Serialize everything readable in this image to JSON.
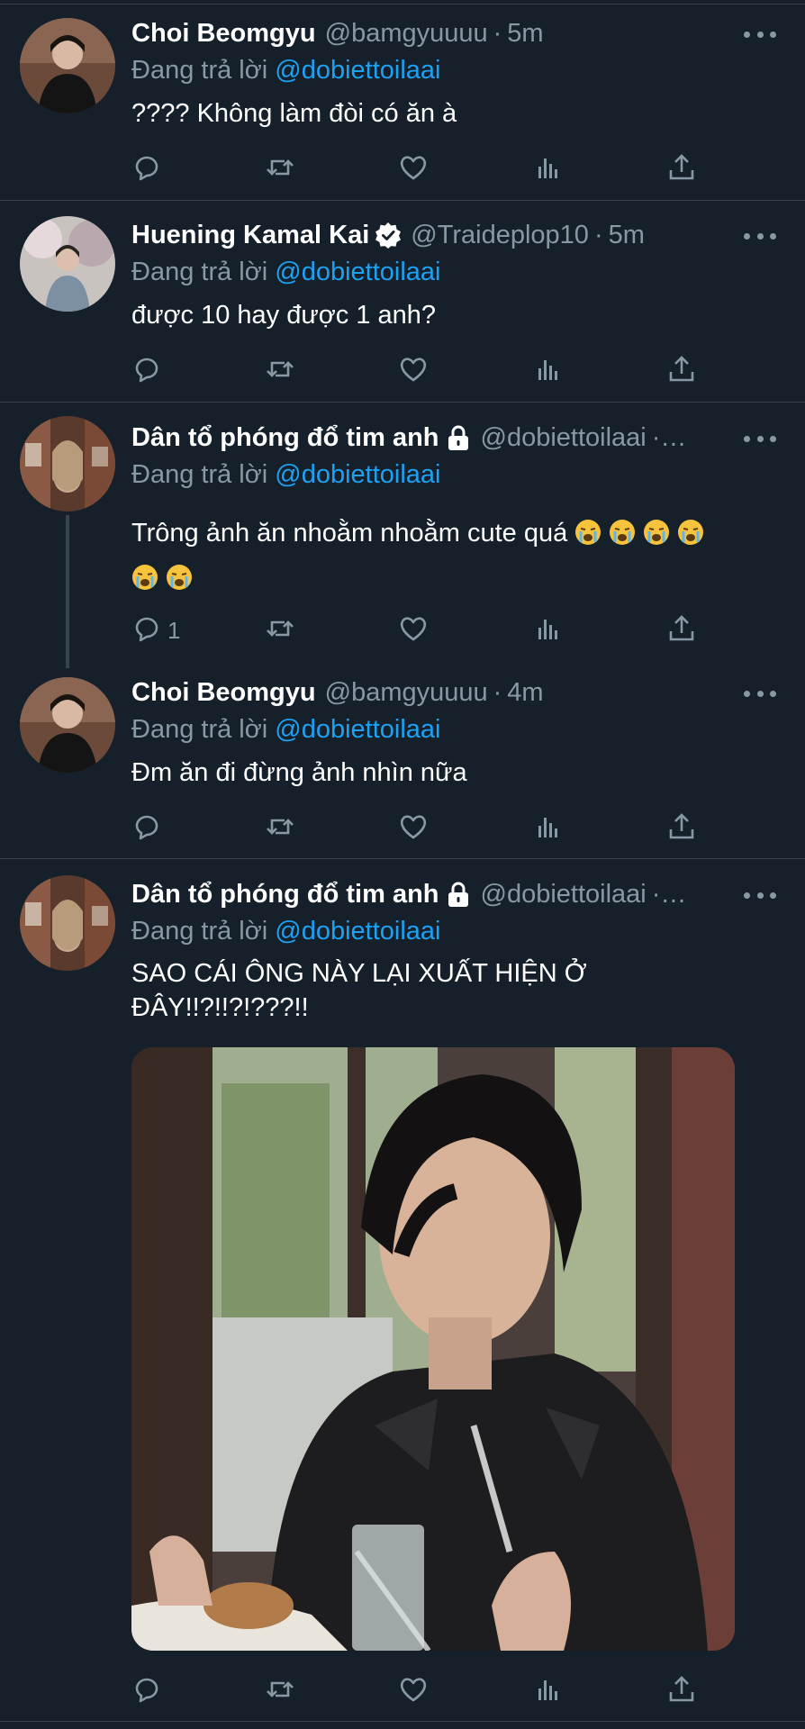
{
  "colors": {
    "background": "#15202b",
    "divider": "#38444d",
    "secondary_text": "#8899a6",
    "link": "#1da1f2",
    "text": "#ffffff"
  },
  "tweets": [
    {
      "name": "Choi Beomgyu",
      "handle": "@bamgyuuuu",
      "sep": "·",
      "time": "5m",
      "reply_prefix": "Đang trả lời",
      "reply_to": "@dobiettoilaai",
      "text": "???? Không làm đòi có ăn à",
      "reply_count": ""
    },
    {
      "name": "Huening Kamal Kai",
      "verified": true,
      "handle": "@Traideplop10",
      "sep": "·",
      "time": "5m",
      "reply_prefix": "Đang trả lời",
      "reply_to": "@dobiettoilaai",
      "text": "được 10 hay được 1 anh?",
      "reply_count": ""
    },
    {
      "name": "Dân tổ phóng đổ tim anh",
      "locked": true,
      "handle": "@dobiettoilaai",
      "sep": "·…",
      "time": "",
      "reply_prefix": "Đang trả lời",
      "reply_to": "@dobiettoilaai",
      "text": "Trông ảnh ăn nhoằm nhoằm cute quá",
      "emoji_name": "loudly-crying-face-emoji",
      "reply_count": "1"
    },
    {
      "name": "Choi Beomgyu",
      "handle": "@bamgyuuuu",
      "sep": "·",
      "time": "4m",
      "reply_prefix": "Đang trả lời",
      "reply_to": "@dobiettoilaai",
      "text": "Đm ăn đi đừng ảnh nhìn nữa",
      "reply_count": ""
    },
    {
      "name": "Dân tổ phóng đổ tim anh",
      "locked": true,
      "handle": "@dobiettoilaai",
      "sep": "·…",
      "time": "",
      "reply_prefix": "Đang trả lời",
      "reply_to": "@dobiettoilaai",
      "text_line1": "SAO CÁI ÔNG NÀY LẠI XUẤT HIỆN Ở",
      "text_line2": "ĐÂY!!?!!?!???!!",
      "reply_count": ""
    }
  ],
  "icons": [
    "reply-icon",
    "retweet-icon",
    "like-icon",
    "views-icon",
    "share-icon",
    "more-icon",
    "verified-icon",
    "lock-icon"
  ]
}
